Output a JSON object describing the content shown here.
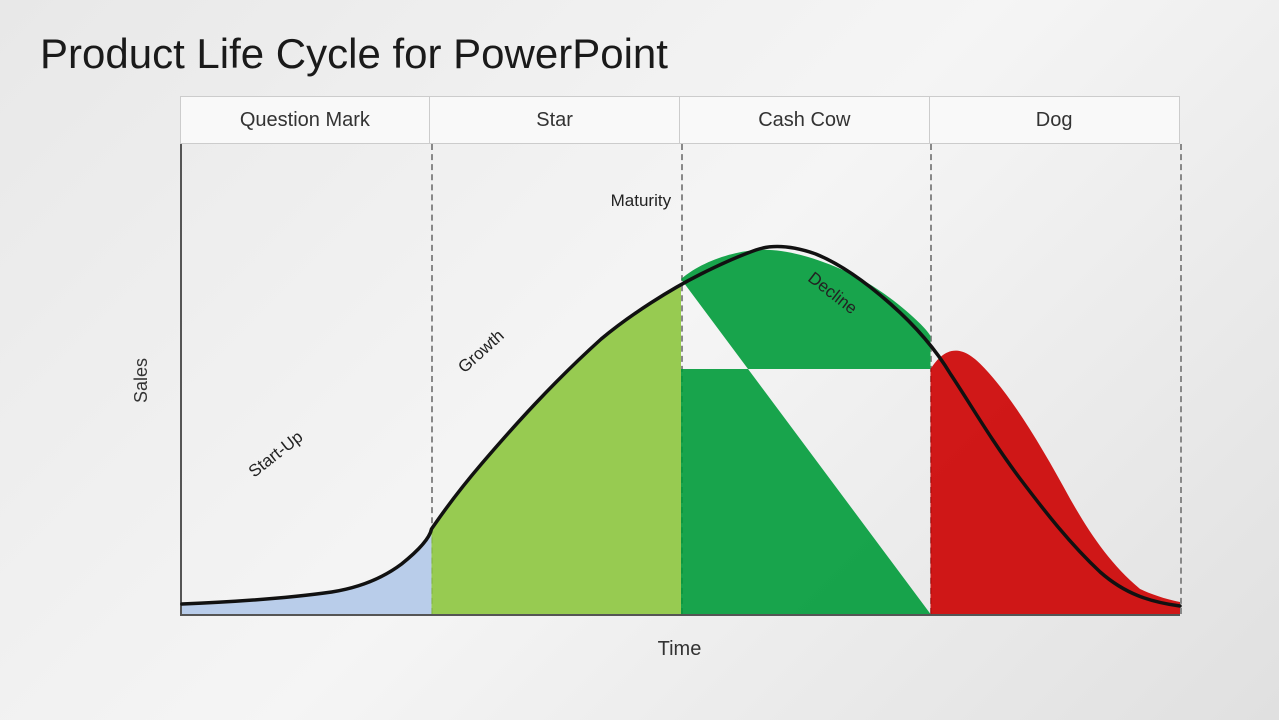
{
  "title": "Product Life Cycle for PowerPoint",
  "categories": [
    {
      "label": "Question Mark"
    },
    {
      "label": "Star"
    },
    {
      "label": "Cash Cow"
    },
    {
      "label": "Dog"
    }
  ],
  "yAxisLabel": "Sales",
  "xAxisLabel": "Time",
  "phases": [
    {
      "label": "Start-Up",
      "rotation": "-38",
      "left": "12%",
      "top": "72%"
    },
    {
      "label": "Growth",
      "rotation": "-42",
      "left": "32%",
      "top": "52%"
    },
    {
      "label": "Maturity",
      "rotation": "0",
      "left": "46%",
      "top": "12%"
    },
    {
      "label": "Decline",
      "rotation": "38",
      "left": "64%",
      "top": "30%"
    }
  ],
  "colors": {
    "background": "#f0f0f0",
    "startup": "#aec6e8",
    "growth": "#8dc63f",
    "maturity": "#009b3a",
    "decline": "#cc0000",
    "curve": "#111111"
  }
}
